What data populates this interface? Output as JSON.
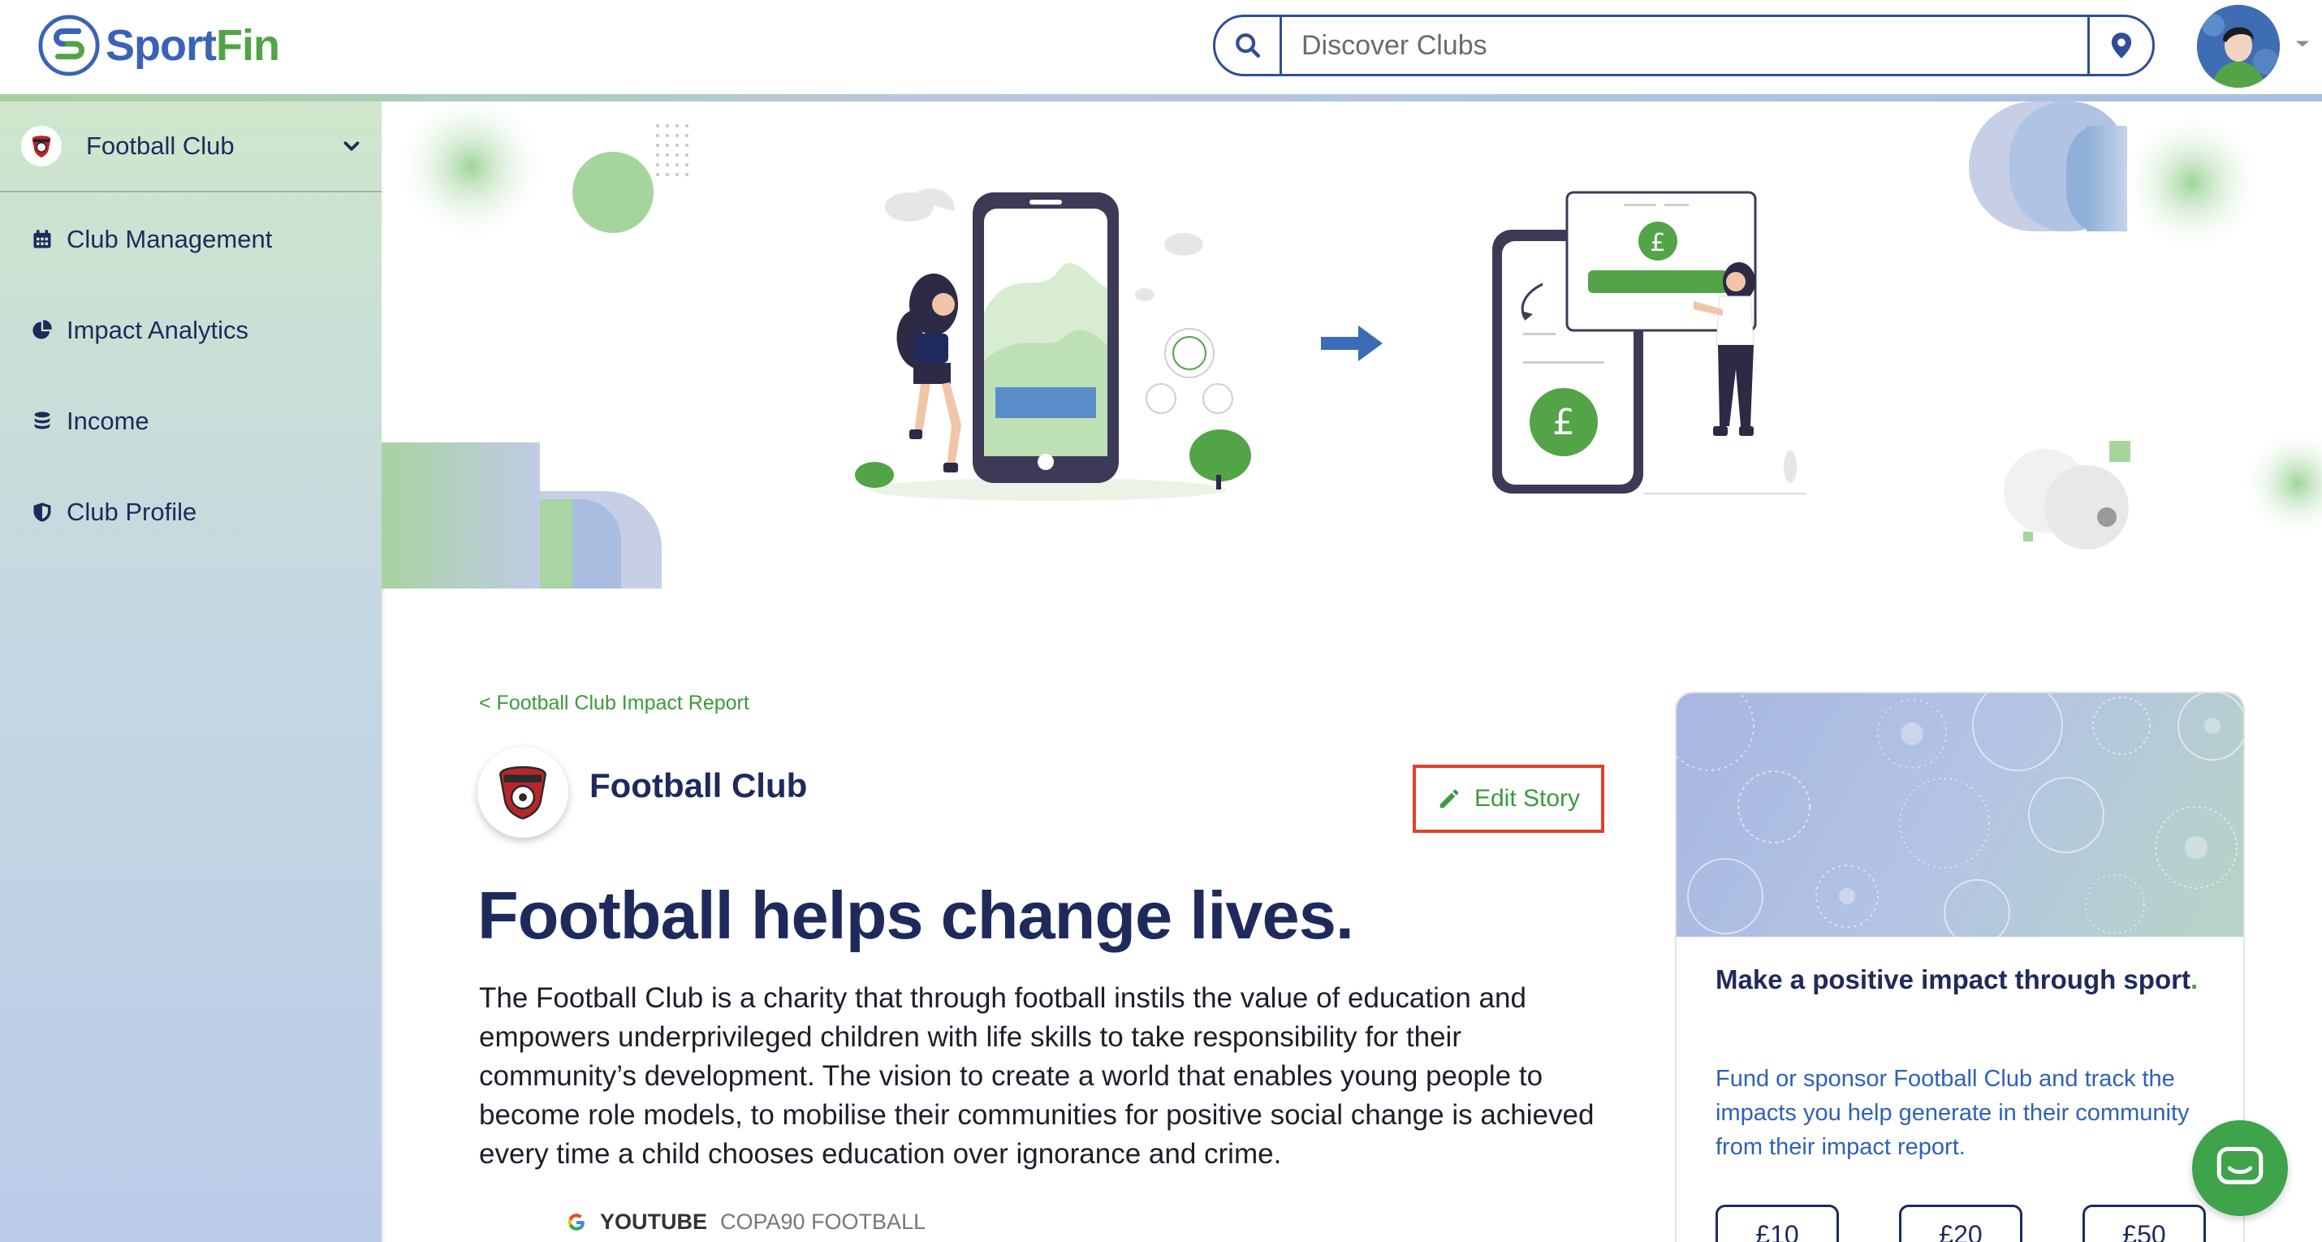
{
  "app": {
    "brand_part1": "Sport",
    "brand_part2": "Fin"
  },
  "search": {
    "placeholder": "Discover Clubs",
    "value": ""
  },
  "sidebar": {
    "club_selector": {
      "label": "Football Club"
    },
    "items": [
      {
        "label": "Club Management",
        "icon": "calendar-icon"
      },
      {
        "label": "Impact Analytics",
        "icon": "pie-chart-icon"
      },
      {
        "label": "Income",
        "icon": "coins-icon"
      },
      {
        "label": "Club Profile",
        "icon": "shield-icon"
      }
    ]
  },
  "main": {
    "breadcrumb": "< Football Club Impact Report",
    "org_name": "Football Club",
    "edit_label": "Edit Story",
    "headline": "Football helps change lives.",
    "story": "The Football Club is a charity that through football instils the value of education and empowers underprivileged children with life skills to take responsibility for their community’s development. The vision to create a world that enables young people to become role models, to mobilise their communities for positive social change is achieved every time a child chooses education over ignorance and crime.",
    "video": {
      "source": "YOUTUBE",
      "title": "COPA90 FOOTBALL"
    }
  },
  "card": {
    "title": "Make a positive impact through sport",
    "title_dot": ".",
    "text": "Fund or sponsor Football Club and track the impacts you help generate in their community from their impact report.",
    "amounts": [
      "£10",
      "£20",
      "£50"
    ]
  },
  "colors": {
    "navy": "#1f2a5c",
    "green": "#52a447",
    "blue": "#2f62b6",
    "highlight": "#e2412b"
  }
}
